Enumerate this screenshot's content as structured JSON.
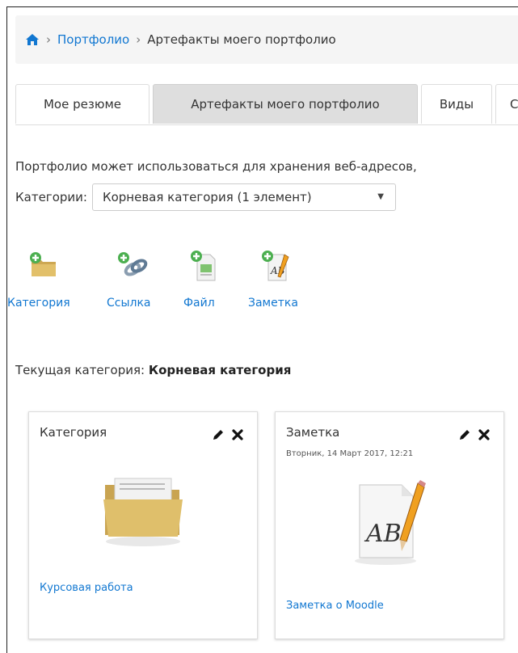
{
  "breadcrumb": {
    "items": [
      "Портфолио",
      "Артефакты моего портфолио"
    ],
    "separator": "›"
  },
  "tabs": [
    {
      "label": "Мое резюме",
      "active": false
    },
    {
      "label": "Артефакты моего портфолио",
      "active": true
    },
    {
      "label": "Виды",
      "active": false
    },
    {
      "label": "С",
      "active": false
    }
  ],
  "description": "Портфолио может использоваться для хранения веб-адресов,",
  "categories": {
    "label": "Категории:",
    "selected": "Корневая категория (1 элемент)"
  },
  "actions": [
    {
      "label": "Категория",
      "icon": "add-folder-icon"
    },
    {
      "label": "Ссылка",
      "icon": "add-link-icon"
    },
    {
      "label": "Файл",
      "icon": "add-file-icon"
    },
    {
      "label": "Заметка",
      "icon": "add-note-icon"
    }
  ],
  "current_category": {
    "label": "Текущая категория:",
    "value": "Корневая категория"
  },
  "cards": [
    {
      "title": "Категория",
      "date": "",
      "link": "Курсовая работа",
      "icon": "folder-icon"
    },
    {
      "title": "Заметка",
      "date": "Вторник, 14 Март 2017, 12:21",
      "link": "Заметка о Moodle",
      "icon": "note-ab-icon"
    }
  ],
  "colors": {
    "link": "#1177d1",
    "tab_active": "#dedede",
    "breadcrumb_bg": "#f5f5f5"
  }
}
